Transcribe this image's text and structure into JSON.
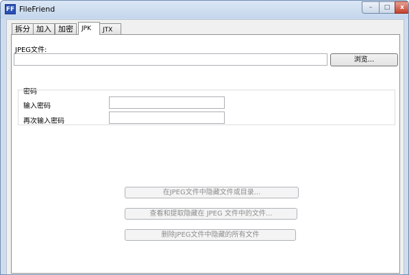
{
  "window": {
    "title": "FileFriend",
    "icon_text": "FF"
  },
  "controls": {
    "minimize": "–",
    "maximize": "□",
    "close": "x"
  },
  "tabs": [
    {
      "label": "拆分"
    },
    {
      "label": "加入"
    },
    {
      "label": "加密"
    },
    {
      "label": "JPK",
      "active": true
    },
    {
      "label": "JTX"
    }
  ],
  "jpk": {
    "file_label": "JPEG文件:",
    "file_value": "",
    "browse_label": "浏览...",
    "password_group": "密码",
    "password_label": "输入密码",
    "password_value": "",
    "confirm_label": "再次输入密码",
    "confirm_value": "",
    "actions": {
      "hide": "在JPEG文件中隐藏文件或目录...",
      "extract": "查看和提取隐藏在 JPEG 文件中的文件...",
      "delete": "删除JPEG文件中隐藏的所有文件"
    }
  }
}
